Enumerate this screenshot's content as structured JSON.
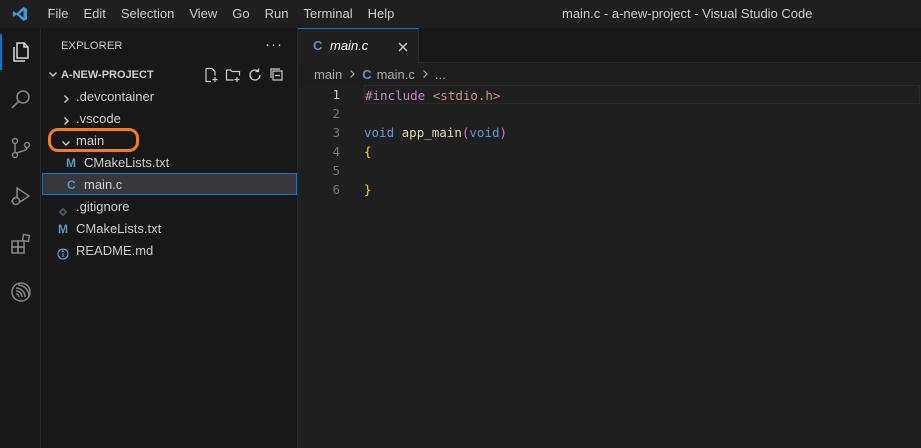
{
  "titlebar": {
    "menu": [
      "File",
      "Edit",
      "Selection",
      "View",
      "Go",
      "Run",
      "Terminal",
      "Help"
    ],
    "window_title": "main.c - a-new-project - Visual Studio Code"
  },
  "activitybar": {
    "icons": [
      "explorer-icon",
      "search-icon",
      "source-control-icon",
      "run-debug-icon",
      "extensions-icon",
      "espressif-icon"
    ]
  },
  "explorer": {
    "header": "EXPLORER",
    "more": "···",
    "project": "A-NEW-PROJECT",
    "tree": [
      {
        "label": ".devcontainer",
        "type": "folder",
        "expanded": false
      },
      {
        "label": ".vscode",
        "type": "folder",
        "expanded": false
      },
      {
        "label": "main",
        "type": "folder",
        "expanded": true
      },
      {
        "label": "CMakeLists.txt",
        "type": "cmake",
        "icon_text": "M"
      },
      {
        "label": "main.c",
        "type": "c",
        "icon_text": "C",
        "selected": true
      },
      {
        "label": ".gitignore",
        "type": "git"
      },
      {
        "label": "CMakeLists.txt",
        "type": "cmake",
        "icon_text": "M"
      },
      {
        "label": "README.md",
        "type": "info"
      }
    ],
    "highlight_color": "#f47b20"
  },
  "editor": {
    "tab": {
      "icon_text": "C",
      "label": "main.c"
    },
    "breadcrumb": {
      "folder": "main",
      "icon_text": "C",
      "file": "main.c",
      "tail": "..."
    },
    "lines": [
      {
        "n": "1",
        "include": "#include",
        "header": "<stdio.h>"
      },
      {
        "n": "2"
      },
      {
        "n": "3",
        "type": "void",
        "fn": "app_main",
        "open": "(",
        "arg": "void",
        "close": ")"
      },
      {
        "n": "4",
        "brace": "{"
      },
      {
        "n": "5"
      },
      {
        "n": "6",
        "brace": "}"
      }
    ]
  },
  "colors": {
    "accent": "#0078d4",
    "c_icon": "#519aba",
    "cmake_icon": "#519aba"
  }
}
